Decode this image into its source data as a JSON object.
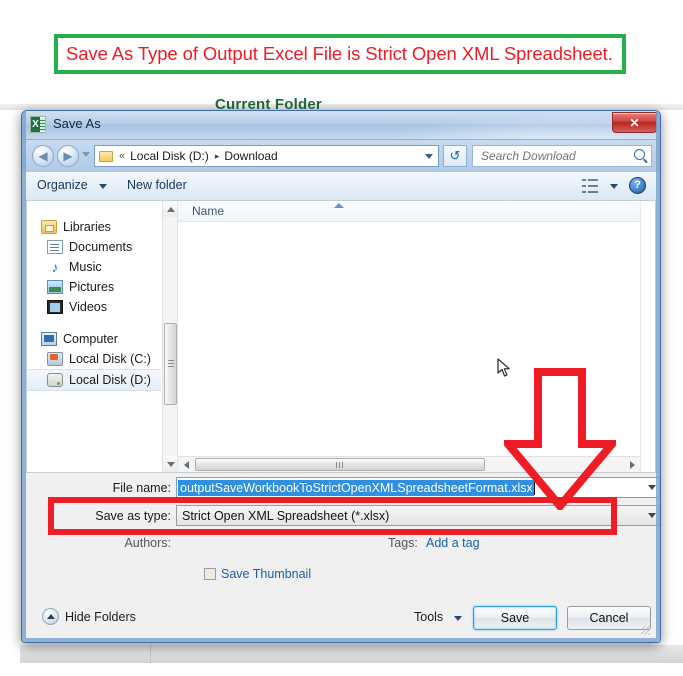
{
  "annotation": {
    "banner_text": "Save As Type of Output Excel File is Strict Open XML Spreadsheet.",
    "banner_border_color": "#22b14c",
    "banner_text_color": "#ed1c24",
    "highlight_box_color": "#ee1c25",
    "arrow_color": "#ee1c25",
    "arrow_points_to": "Save as type"
  },
  "background": {
    "partial_label": "Current Folder",
    "partial_label_color": "#1f6b3b"
  },
  "dialog": {
    "title": "Save As",
    "app_icon": "excel-icon",
    "close_label": "✕",
    "address": {
      "folder_icon": "folder-icon",
      "overflow_chevron": "«",
      "crumbs": [
        "Local Disk (D:)",
        "Download"
      ],
      "separator": "▸",
      "dropdown_icon": "chevron-down-icon",
      "refresh_icon": "refresh-icon"
    },
    "search": {
      "placeholder": "Search Download",
      "icon": "search-icon"
    },
    "toolbar": {
      "organize_label": "Organize",
      "new_folder_label": "New folder",
      "view_icon": "view-layout-icon",
      "help_icon": "help-icon",
      "help_glyph": "?"
    },
    "nav_pane": {
      "groups": [
        {
          "root": {
            "label": "Libraries",
            "icon": "libraries-icon"
          },
          "children": [
            {
              "label": "Documents",
              "icon": "documents-icon"
            },
            {
              "label": "Music",
              "icon": "music-icon"
            },
            {
              "label": "Pictures",
              "icon": "pictures-icon"
            },
            {
              "label": "Videos",
              "icon": "videos-icon"
            }
          ]
        },
        {
          "root": {
            "label": "Computer",
            "icon": "computer-icon"
          },
          "children": [
            {
              "label": "Local Disk (C:)",
              "icon": "disk-c-icon",
              "selected": false
            },
            {
              "label": "Local Disk (D:)",
              "icon": "disk-d-icon",
              "selected": true
            }
          ]
        }
      ],
      "scrollbar": {
        "up_icon": "scroll-up-icon",
        "down_icon": "scroll-down-icon"
      }
    },
    "file_list": {
      "columns": [
        "Name"
      ],
      "rows": [],
      "sort_icon": "sort-ascending-icon",
      "hscroll": {
        "left_icon": "scroll-left-icon",
        "right_icon": "scroll-right-icon"
      }
    },
    "form": {
      "file_name_label": "File name:",
      "file_name_value": "outputSaveWorkbookToStrictOpenXMLSpreadsheetFormat.xlsx",
      "file_name_dropdown_icon": "chevron-down-icon",
      "save_as_type_label": "Save as type:",
      "save_as_type_value": "Strict Open XML Spreadsheet (*.xlsx)",
      "save_as_type_dropdown_icon": "chevron-down-icon",
      "authors_label": "Authors:",
      "authors_value": "",
      "tags_label": "Tags:",
      "tags_link": "Add a tag",
      "save_thumbnail_label": "Save Thumbnail",
      "save_thumbnail_checked": false
    },
    "footer": {
      "hide_folders_label": "Hide Folders",
      "hide_folders_icon": "collapse-icon",
      "tools_label": "Tools",
      "tools_caret_icon": "chevron-down-icon",
      "save_label": "Save",
      "cancel_label": "Cancel"
    }
  }
}
